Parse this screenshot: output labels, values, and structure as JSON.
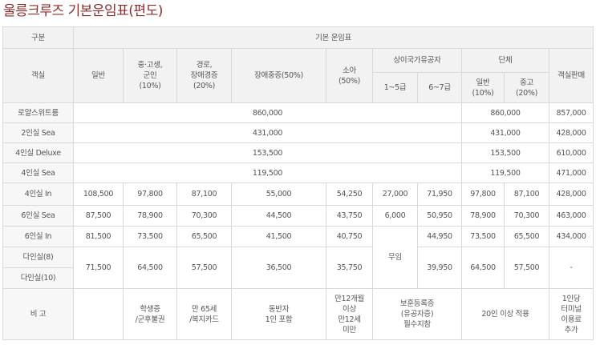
{
  "title": "울릉크루즈 기본운임표(편도)",
  "header": {
    "gubun": "구분",
    "basic_fare": "기본 운임표",
    "room": "객실",
    "general": "일반",
    "student_1": "중·고생,",
    "student_2": "군인",
    "student_3": "(10%)",
    "senior_1": "경로,",
    "senior_2": "장애경증",
    "senior_3": "(20%)",
    "disabled": "장애중증(50%)",
    "child_1": "소아",
    "child_2": "(50%)",
    "veteran": "상이국가유공자",
    "vet_1_5": "1~5급",
    "vet_6_7": "6~7급",
    "group": "단체",
    "group_general_1": "일반",
    "group_general_2": "(10%)",
    "group_middle_1": "중고",
    "group_middle_2": "(20%)",
    "room_sales": "객실판매"
  },
  "rows": {
    "royal": {
      "name": "로얄스위트룸",
      "fare": "860,000",
      "group": "860,000",
      "sales": "857,000"
    },
    "sea2": {
      "name": "2인실 Sea",
      "fare": "431,000",
      "group": "431,000",
      "sales": "428,000"
    },
    "deluxe4": {
      "name": "4인실 Deluxe",
      "fare": "153,500",
      "group": "153,500",
      "sales": "610,000"
    },
    "sea4": {
      "name": "4인실 Sea",
      "fare": "119,500",
      "group": "119,500",
      "sales": "471,000"
    },
    "in4": {
      "name": "4인실 In",
      "general": "108,500",
      "student": "97,800",
      "senior": "87,100",
      "disabled": "55,000",
      "child": "54,250",
      "vet15": "27,000",
      "vet67": "71,950",
      "group_general": "97,800",
      "group_middle": "87,100",
      "sales": "428,000"
    },
    "sea6": {
      "name": "6인실 Sea",
      "general": "87,500",
      "student": "78,900",
      "senior": "70,300",
      "disabled": "44,500",
      "child": "43,750",
      "vet15": "6,000",
      "vet67": "50,950",
      "group_general": "78,900",
      "group_middle": "70,300",
      "sales": "463,000"
    },
    "in6": {
      "name": "6인실 In",
      "general": "81,500",
      "student": "73,500",
      "senior": "65,500",
      "disabled": "41,500",
      "child": "40,750",
      "vet67": "44,950",
      "group_general": "73,500",
      "group_middle": "65,500",
      "sales": "434,000"
    },
    "multi8": {
      "name": "다인실(8)"
    },
    "multi10": {
      "name": "다인실(10)"
    },
    "multi": {
      "general": "71,500",
      "student": "64,500",
      "senior": "57,500",
      "disabled": "36,500",
      "child": "35,750",
      "vet15": "무임",
      "vet67": "39,950",
      "group_general": "64,500",
      "group_middle": "57,500",
      "sales": "-"
    }
  },
  "notes": {
    "label": "비 고",
    "student_1": "학생증",
    "student_2": "/군후불권",
    "senior_1": "만 65세",
    "senior_2": "/복지카드",
    "disabled_1": "동반자",
    "disabled_2": "1인 포함",
    "child_1": "만12개월",
    "child_2": "이상",
    "child_3": "만12세",
    "child_4": "미만",
    "vet_1": "보훈등록증",
    "vet_2": "(유공자증)",
    "vet_3": "필수지참",
    "group": "20인 이상 적용",
    "sales_1": "1인당",
    "sales_2": "터미널",
    "sales_3": "이용료",
    "sales_4": "추가"
  }
}
